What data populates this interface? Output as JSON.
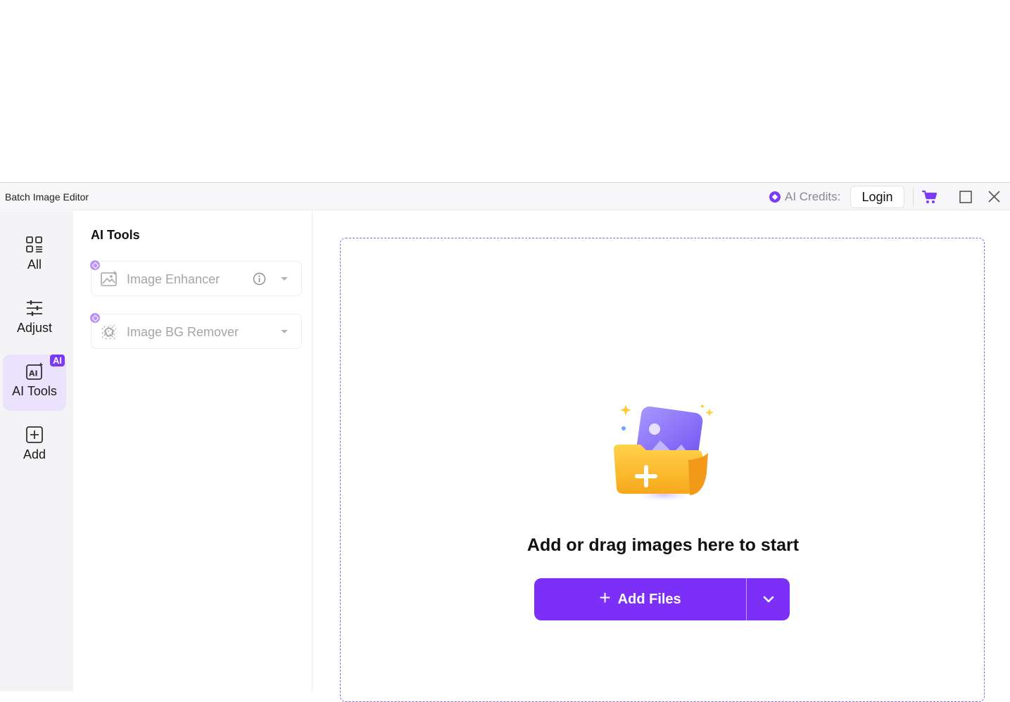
{
  "window": {
    "title": "Batch Image Editor",
    "credits_label": "AI Credits:",
    "login_label": "Login"
  },
  "rail": {
    "items": [
      {
        "label": "All",
        "icon": "grid-list-icon",
        "active": false
      },
      {
        "label": "Adjust",
        "icon": "sliders-icon",
        "active": false
      },
      {
        "label": "AI Tools",
        "icon": "ai-tools-icon",
        "active": true,
        "badge": "AI"
      },
      {
        "label": "Add",
        "icon": "plus-square-icon",
        "active": false
      }
    ]
  },
  "panel": {
    "title": "AI Tools",
    "tools": [
      {
        "label": "Image Enhancer",
        "icon": "image-enhancer-icon",
        "has_info": true
      },
      {
        "label": "Image BG Remover",
        "icon": "bg-remover-icon",
        "has_info": false
      }
    ]
  },
  "dropzone": {
    "message": "Add or drag images here to start",
    "add_files_label": "Add Files",
    "add_files_plus": "+"
  },
  "colors": {
    "accent": "#7b2ff7",
    "active_rail_bg": "#ebe2fd",
    "dashed_border": "#8f5ef0"
  }
}
